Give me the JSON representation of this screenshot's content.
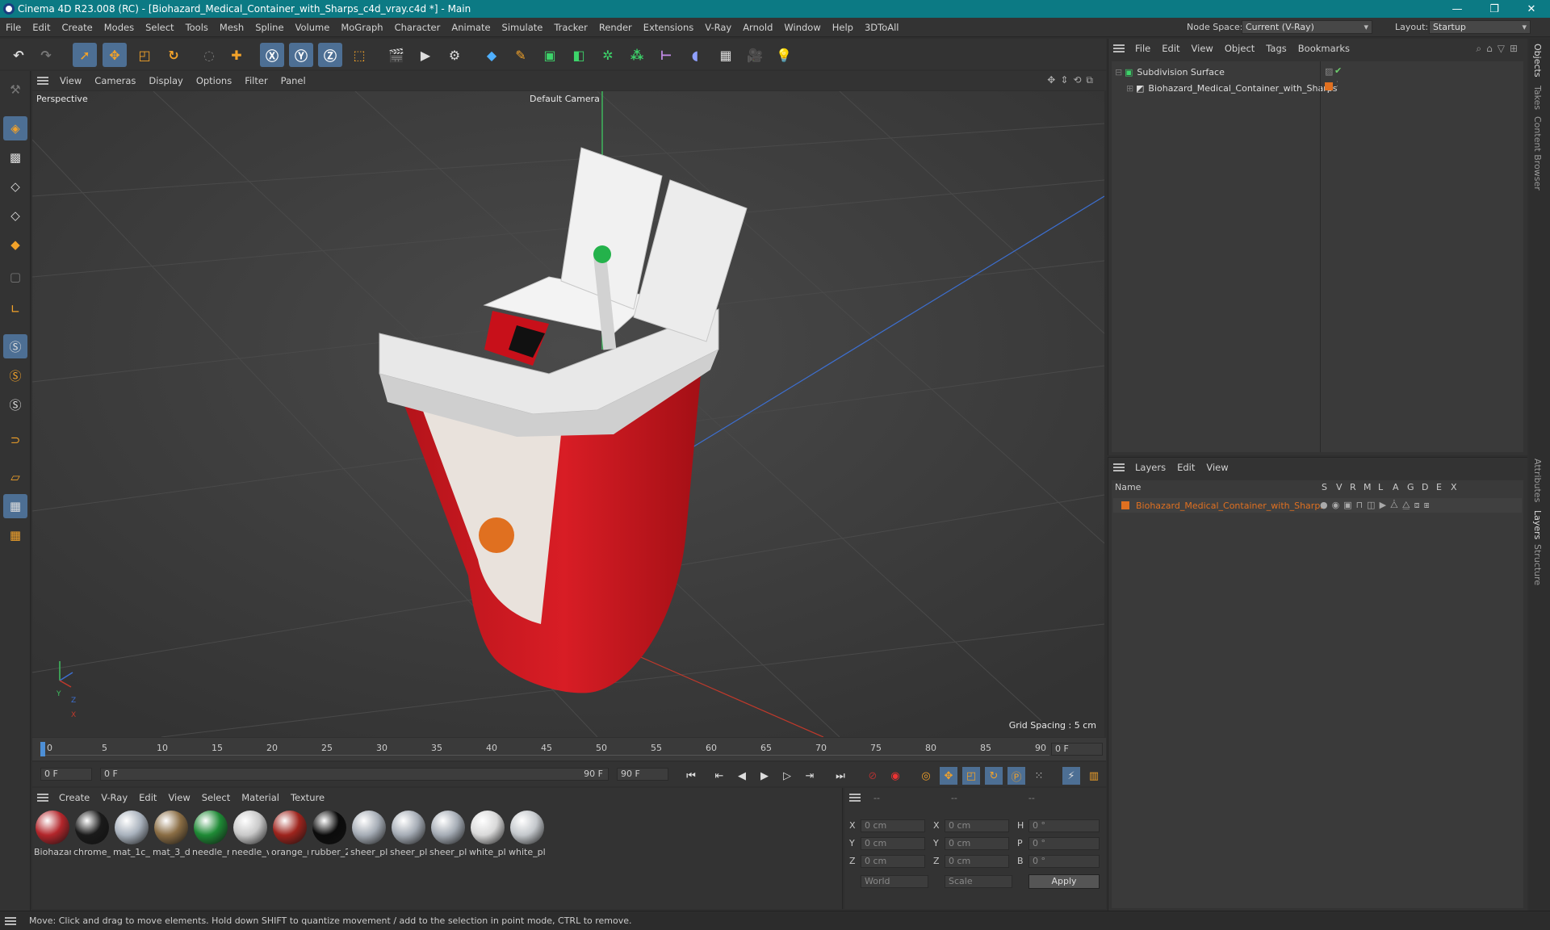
{
  "window": {
    "title": "Cinema 4D R23.008 (RC) - [Biohazard_Medical_Container_with_Sharps_c4d_vray.c4d *] - Main",
    "controls": [
      "—",
      "❐",
      "✕"
    ]
  },
  "menubar": {
    "items": [
      "File",
      "Edit",
      "Create",
      "Modes",
      "Select",
      "Tools",
      "Mesh",
      "Spline",
      "Volume",
      "MoGraph",
      "Character",
      "Animate",
      "Simulate",
      "Tracker",
      "Render",
      "Extensions",
      "V-Ray",
      "Arnold",
      "Window",
      "Help",
      "3DToAll"
    ],
    "node_space_label": "Node Space:",
    "node_space_value": "Current (V-Ray)",
    "layout_label": "Layout:",
    "layout_value": "Startup"
  },
  "viewport": {
    "menu": [
      "View",
      "Cameras",
      "Display",
      "Options",
      "Filter",
      "Panel"
    ],
    "name": "Perspective",
    "camera": "Default Camera",
    "grid_spacing": "Grid Spacing : 5 cm",
    "axis_y": "Y",
    "axis_z": "Z",
    "axis_x": "X"
  },
  "timeline": {
    "ticks": [
      "0",
      "5",
      "10",
      "15",
      "20",
      "25",
      "30",
      "35",
      "40",
      "45",
      "50",
      "55",
      "60",
      "65",
      "70",
      "75",
      "80",
      "85",
      "90"
    ],
    "frame_display": "0 F",
    "current_frame": "0 F",
    "range_start": "0 F",
    "range_end_inner": "90 F",
    "range_end": "90 F"
  },
  "material_manager": {
    "menu": [
      "Create",
      "V-Ray",
      "Edit",
      "View",
      "Select",
      "Material",
      "Texture"
    ],
    "materials": [
      {
        "name": "Biohazar",
        "color": "#b3262b"
      },
      {
        "name": "chrome_",
        "color": "#1a1a1a"
      },
      {
        "name": "mat_1c_l",
        "color": "#a9b2bd"
      },
      {
        "name": "mat_3_d",
        "color": "#8a6d44"
      },
      {
        "name": "needle_r",
        "color": "#1e8a35"
      },
      {
        "name": "needle_v",
        "color": "#c9c9c9"
      },
      {
        "name": "orange_r",
        "color": "#9e241d"
      },
      {
        "name": "rubber_2",
        "color": "#0b0b0b"
      },
      {
        "name": "sheer_pl",
        "color": "#a6adb6"
      },
      {
        "name": "sheer_pl",
        "color": "#a6adb6"
      },
      {
        "name": "sheer_pl",
        "color": "#a6adb6"
      },
      {
        "name": "white_pl",
        "color": "#d9d9d9"
      },
      {
        "name": "white_pl",
        "color": "#c4c8cc"
      }
    ]
  },
  "coordinates": {
    "header": [
      "--",
      "--",
      "--"
    ],
    "rows": [
      {
        "a": "X",
        "av": "0 cm",
        "b": "X",
        "bv": "0 cm",
        "c": "H",
        "cv": "0 °"
      },
      {
        "a": "Y",
        "av": "0 cm",
        "b": "Y",
        "bv": "0 cm",
        "c": "P",
        "cv": "0 °"
      },
      {
        "a": "Z",
        "av": "0 cm",
        "b": "Z",
        "bv": "0 cm",
        "c": "B",
        "cv": "0 °"
      }
    ],
    "mode": "World",
    "type": "Scale",
    "apply": "Apply"
  },
  "objects": {
    "menu": [
      "File",
      "Edit",
      "View",
      "Object",
      "Tags",
      "Bookmarks"
    ],
    "items": [
      {
        "name": "Subdivision Surface"
      },
      {
        "name": "Biohazard_Medical_Container_with_Sharps"
      }
    ]
  },
  "layers": {
    "menu": [
      "Layers",
      "Edit",
      "View"
    ],
    "columns": [
      "Name",
      "S",
      "V",
      "R",
      "M",
      "L",
      "A",
      "G",
      "D",
      "E",
      "X"
    ],
    "items": [
      {
        "name": "Biohazard_Medical_Container_with_Sharps",
        "color": "#e07020"
      }
    ]
  },
  "side_tabs": [
    "Objects",
    "Takes",
    "Content Browser",
    "Attributes",
    "Layers",
    "Structure"
  ],
  "status": "Move: Click and drag to move elements. Hold down SHIFT to quantize movement / add to the selection in point mode, CTRL to remove.",
  "colors": {
    "titlebar": "#0c7a84",
    "highlight": "#4d6f94",
    "orange": "#e07020"
  }
}
